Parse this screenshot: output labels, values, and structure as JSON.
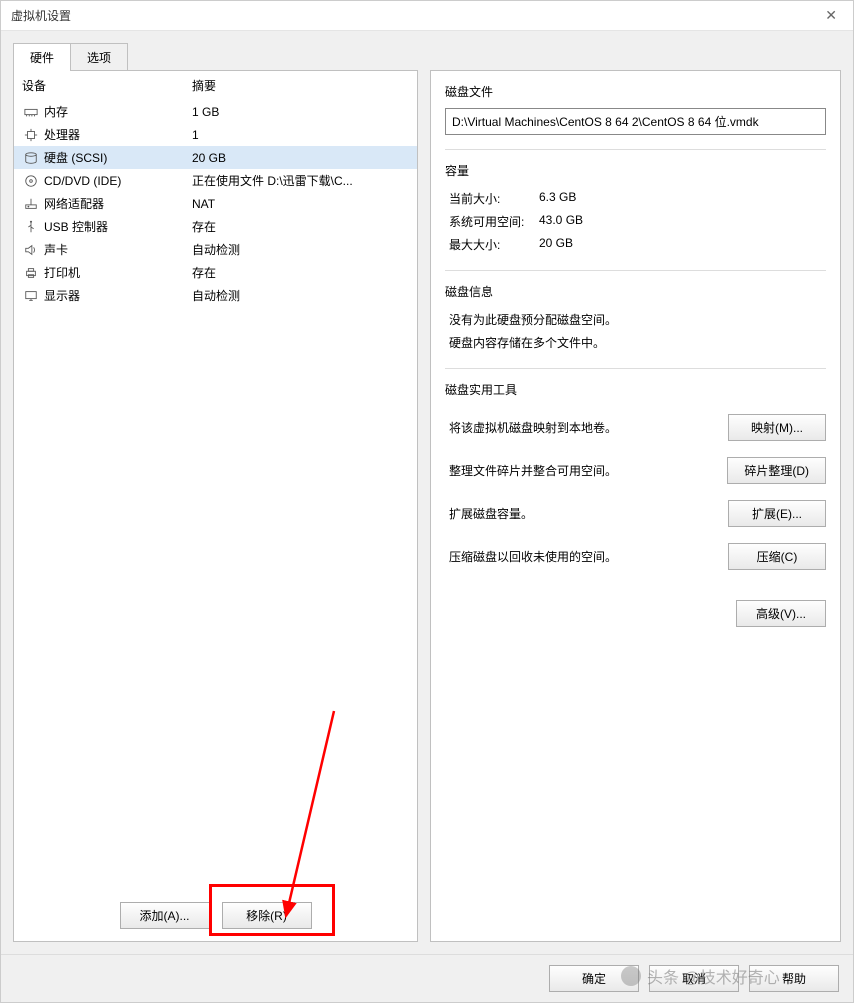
{
  "window": {
    "title": "虚拟机设置"
  },
  "tabs": {
    "hardware": "硬件",
    "options": "选项"
  },
  "devlist": {
    "col_device": "设备",
    "col_summary": "摘要",
    "items": [
      {
        "name": "内存",
        "summary": "1 GB",
        "icon": "memory"
      },
      {
        "name": "处理器",
        "summary": "1",
        "icon": "cpu"
      },
      {
        "name": "硬盘 (SCSI)",
        "summary": "20 GB",
        "icon": "disk",
        "selected": true
      },
      {
        "name": "CD/DVD (IDE)",
        "summary": "正在使用文件 D:\\迅雷下载\\C...",
        "icon": "cd"
      },
      {
        "name": "网络适配器",
        "summary": "NAT",
        "icon": "net"
      },
      {
        "name": "USB 控制器",
        "summary": "存在",
        "icon": "usb"
      },
      {
        "name": "声卡",
        "summary": "自动检测",
        "icon": "sound"
      },
      {
        "name": "打印机",
        "summary": "存在",
        "icon": "printer"
      },
      {
        "name": "显示器",
        "summary": "自动检测",
        "icon": "display"
      }
    ]
  },
  "left_buttons": {
    "add": "添加(A)...",
    "remove": "移除(R)"
  },
  "right": {
    "diskfile_title": "磁盘文件",
    "diskfile_path": "D:\\Virtual Machines\\CentOS 8 64 2\\CentOS 8 64 位.vmdk",
    "capacity_title": "容量",
    "cap_current_label": "当前大小:",
    "cap_current_val": "6.3 GB",
    "cap_free_label": "系统可用空间:",
    "cap_free_val": "43.0 GB",
    "cap_max_label": "最大大小:",
    "cap_max_val": "20 GB",
    "info_title": "磁盘信息",
    "info_line1": "没有为此硬盘预分配磁盘空间。",
    "info_line2": "硬盘内容存储在多个文件中。",
    "util_title": "磁盘实用工具",
    "util_map_desc": "将该虚拟机磁盘映射到本地卷。",
    "util_map_btn": "映射(M)...",
    "util_defrag_desc": "整理文件碎片并整合可用空间。",
    "util_defrag_btn": "碎片整理(D)",
    "util_expand_desc": "扩展磁盘容量。",
    "util_expand_btn": "扩展(E)...",
    "util_compact_desc": "压缩磁盘以回收未使用的空间。",
    "util_compact_btn": "压缩(C)",
    "advanced_btn": "高级(V)..."
  },
  "footer": {
    "ok": "确定",
    "cancel": "取消",
    "help": "帮助"
  },
  "watermark": "头条 @技术好奇心"
}
